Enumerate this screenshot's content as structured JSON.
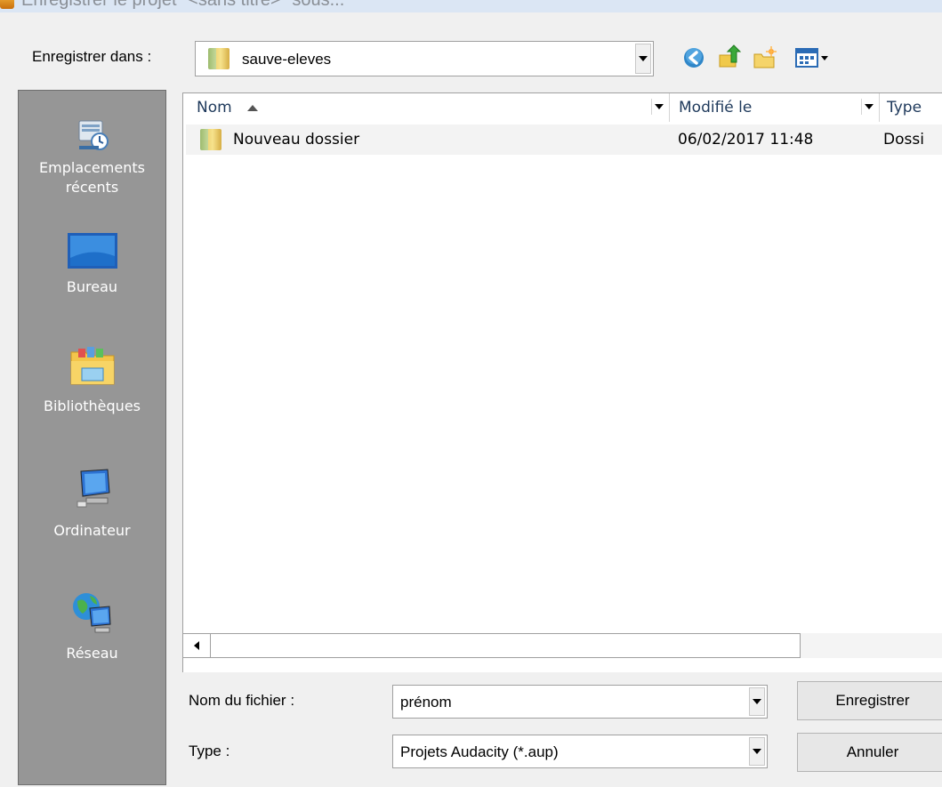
{
  "window": {
    "title": "Enregistrer le projet \"<sans titre>\" sous..."
  },
  "toolbar": {
    "save_in_label": "Enregistrer dans :",
    "location_value": "sauve-eleves",
    "icons": [
      "back-icon",
      "up-folder-icon",
      "new-folder-icon",
      "view-menu-icon"
    ]
  },
  "places": [
    {
      "label": "Emplacements récents",
      "icon": "recent-places-icon"
    },
    {
      "label": "Bureau",
      "icon": "desktop-icon"
    },
    {
      "label": "Bibliothèques",
      "icon": "libraries-icon"
    },
    {
      "label": "Ordinateur",
      "icon": "computer-icon"
    },
    {
      "label": "Réseau",
      "icon": "network-icon"
    }
  ],
  "file_list": {
    "columns": [
      "Nom",
      "Modifié le",
      "Type"
    ],
    "rows": [
      {
        "name": "Nouveau dossier",
        "modified": "06/02/2017 11:48",
        "type": "Dossi"
      }
    ]
  },
  "footer": {
    "filename_label": "Nom du fichier :",
    "filename_value": "prénom",
    "type_label": "Type :",
    "type_value": "Projets Audacity (*.aup)",
    "save_button": "Enregistrer",
    "cancel_button": "Annuler"
  }
}
